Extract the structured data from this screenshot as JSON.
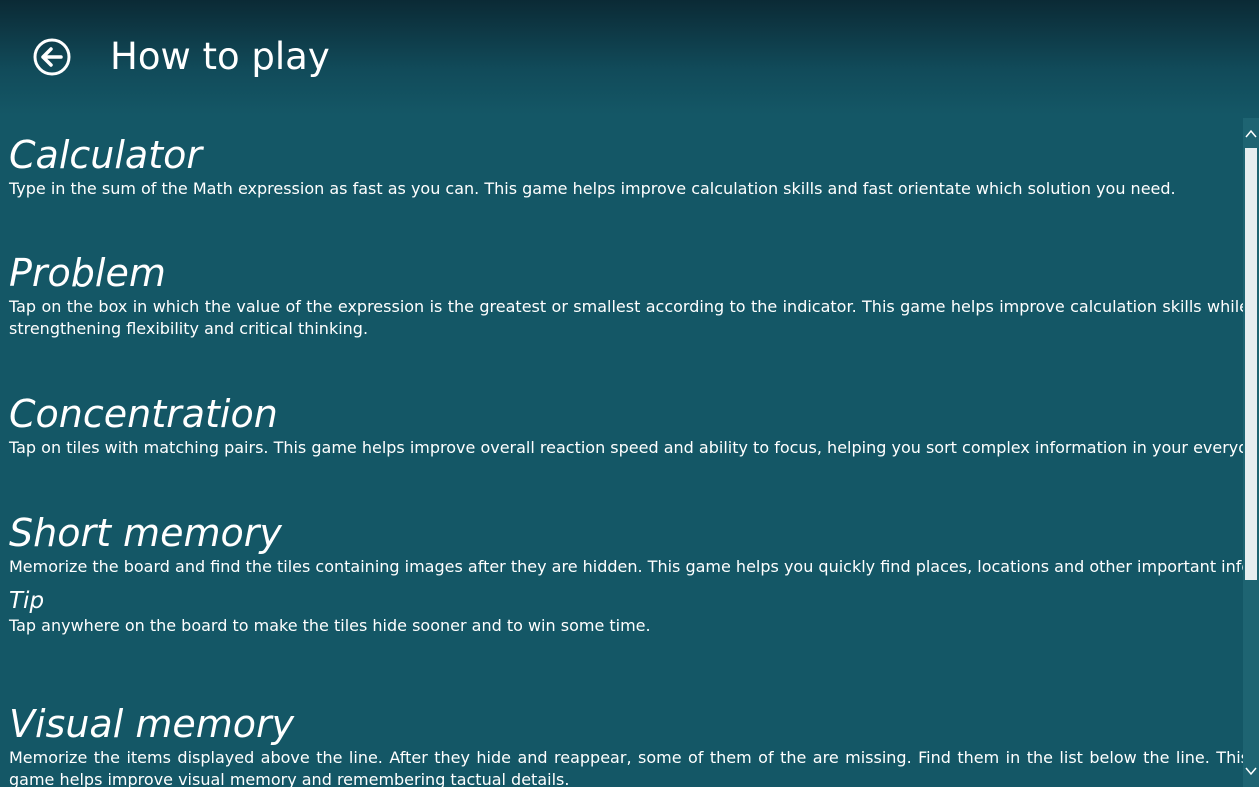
{
  "header": {
    "title": "How to play",
    "back_icon": "back-arrow-circle-icon"
  },
  "sections": [
    {
      "title": "Calculator",
      "text": "Type in the sum of the Math expression as fast as you can. This game helps improve calculation skills and fast orientate which solution you need."
    },
    {
      "title": "Problem",
      "text": "Tap on the box in which the value of the expression is the greatest or smallest according to the indicator. This game helps improve calculation skills while strengthening flexibility and critical thinking."
    },
    {
      "title": "Concentration",
      "text": "Tap on tiles with matching pairs. This game helps improve overall reaction speed and ability to focus, helping you sort complex information in your everyday life."
    },
    {
      "title": "Short memory",
      "text": "Memorize the board and find the tiles containing images after they are hidden. This game helps you quickly find places, locations and other important information.",
      "tip_title": "Tip",
      "tip_text": "Tap anywhere on the board to make the tiles hide sooner and to win some time."
    },
    {
      "title": "Visual memory",
      "text": "Memorize the items displayed above the line. After they hide and reappear, some of them of the are missing. Find them in the list below the line. This game helps improve visual memory and remembering tactual details."
    }
  ],
  "colors": {
    "background": "#145766",
    "header_top": "#0b2a35",
    "text": "#ffffff",
    "scrollbar_track": "#1e6472",
    "scrollbar_thumb": "#e6eef0"
  }
}
